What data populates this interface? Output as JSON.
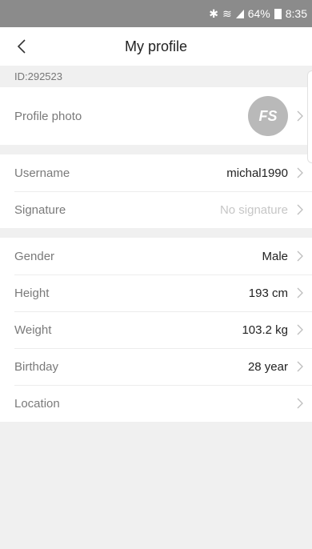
{
  "status_bar": {
    "battery": "64%",
    "time": "8:35"
  },
  "header": {
    "title": "My profile"
  },
  "user_id": "ID:292523",
  "profile_photo": {
    "label": "Profile photo",
    "avatar_text": "FS"
  },
  "account": {
    "username_label": "Username",
    "username_value": "michal1990",
    "signature_label": "Signature",
    "signature_value": "No signature"
  },
  "details": {
    "gender_label": "Gender",
    "gender_value": "Male",
    "height_label": "Height",
    "height_value": "193 cm",
    "weight_label": "Weight",
    "weight_value": "103.2 kg",
    "birthday_label": "Birthday",
    "birthday_value": "28 year",
    "location_label": "Location",
    "location_value": ""
  },
  "colors": {
    "status_bar": "#8b8b8b",
    "background": "#f0f0f0",
    "avatar": "#b9b9b9"
  }
}
